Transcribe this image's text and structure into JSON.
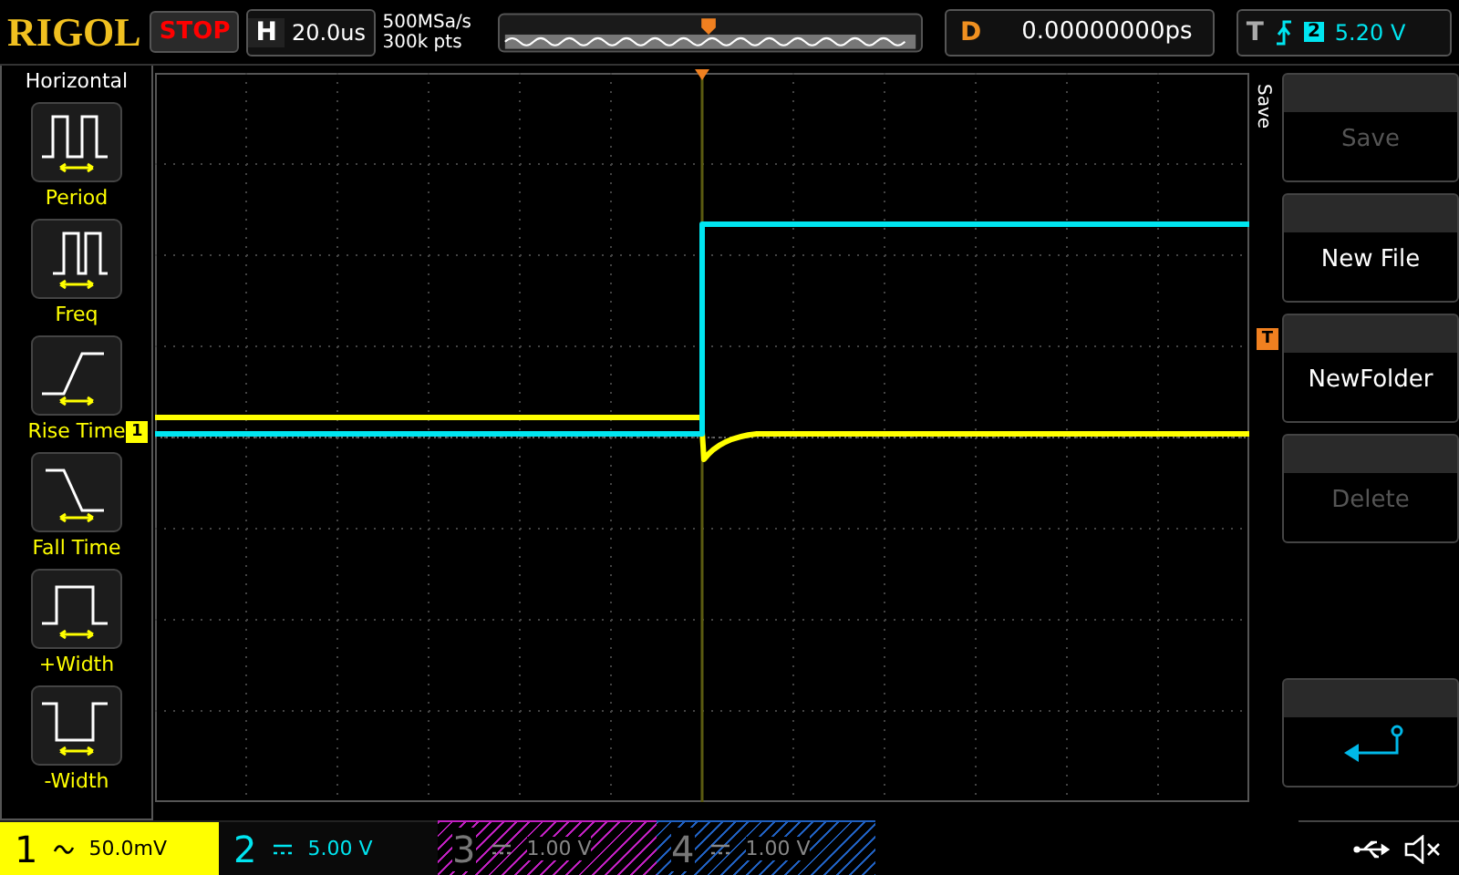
{
  "top_bar": {
    "brand": "RIGOL",
    "run_state": "STOP",
    "horizontal": {
      "label": "H",
      "timebase": "20.0us"
    },
    "sample": {
      "rate": "500MSa/s",
      "depth": "300k pts"
    },
    "delay": {
      "label": "D",
      "value": "0.00000000ps"
    },
    "trigger": {
      "label": "T",
      "source": "2",
      "level": "5.20 V"
    }
  },
  "left_menu": {
    "title": "Horizontal",
    "items": [
      {
        "label": "Period",
        "kind": "period"
      },
      {
        "label": "Freq",
        "kind": "freq"
      },
      {
        "label": "Rise Time",
        "kind": "rise"
      },
      {
        "label": "Fall Time",
        "kind": "fall"
      },
      {
        "label": "+Width",
        "kind": "pwidth"
      },
      {
        "label": "-Width",
        "kind": "nwidth"
      }
    ]
  },
  "screen": {
    "channel_marker": "1",
    "trigger_marker": "T"
  },
  "right_menu": {
    "title": "Save",
    "buttons": [
      {
        "label": "Save",
        "disabled": true
      },
      {
        "label": "New File",
        "disabled": false
      },
      {
        "label": "NewFolder",
        "disabled": false
      },
      {
        "label": "Delete",
        "disabled": true
      }
    ]
  },
  "channels": [
    {
      "number": "1",
      "kind": "ac",
      "scale": "50.0mV",
      "color": "#ffff00",
      "on": true
    },
    {
      "number": "2",
      "kind": "dc",
      "scale": "5.00 V",
      "color": "#00e5f0",
      "on": true
    },
    {
      "number": "3",
      "kind": "dc",
      "scale": "1.00 V",
      "color": "#c020c0",
      "on": false
    },
    {
      "number": "4",
      "kind": "dc",
      "scale": "1.00 V",
      "color": "#2060c0",
      "on": false
    }
  ]
}
